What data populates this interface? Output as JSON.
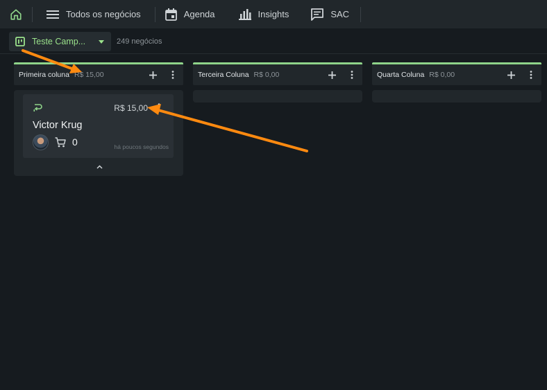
{
  "nav": {
    "home_icon": "home-icon",
    "items": [
      {
        "label": "Todos os negócios",
        "icon": "list-icon"
      },
      {
        "label": "Agenda",
        "icon": "calendar-icon"
      },
      {
        "label": "Insights",
        "icon": "bar-chart-icon"
      },
      {
        "label": "SAC",
        "icon": "message-icon"
      }
    ]
  },
  "toolbar": {
    "pipeline_label": "Teste Camp...",
    "pipeline_icon": "kanban-icon",
    "deal_count": "249 negócios"
  },
  "columns": [
    {
      "name": "Primeira coluna",
      "value": "R$ 15,00",
      "cards": [
        {
          "value": "R$ 15,00",
          "name": "Victor Krug",
          "cart_count": "0",
          "time": "há poucos segundos"
        }
      ]
    },
    {
      "name": "Terceira Coluna",
      "value": "R$ 0,00",
      "cards": []
    },
    {
      "name": "Quarta Coluna",
      "value": "R$ 0,00",
      "cards": []
    }
  ],
  "colors": {
    "accent": "#8fd48a",
    "background": "#161b1f",
    "panel": "#21272b",
    "card": "#2a3035",
    "annotation_arrow": "#ff8a10"
  }
}
